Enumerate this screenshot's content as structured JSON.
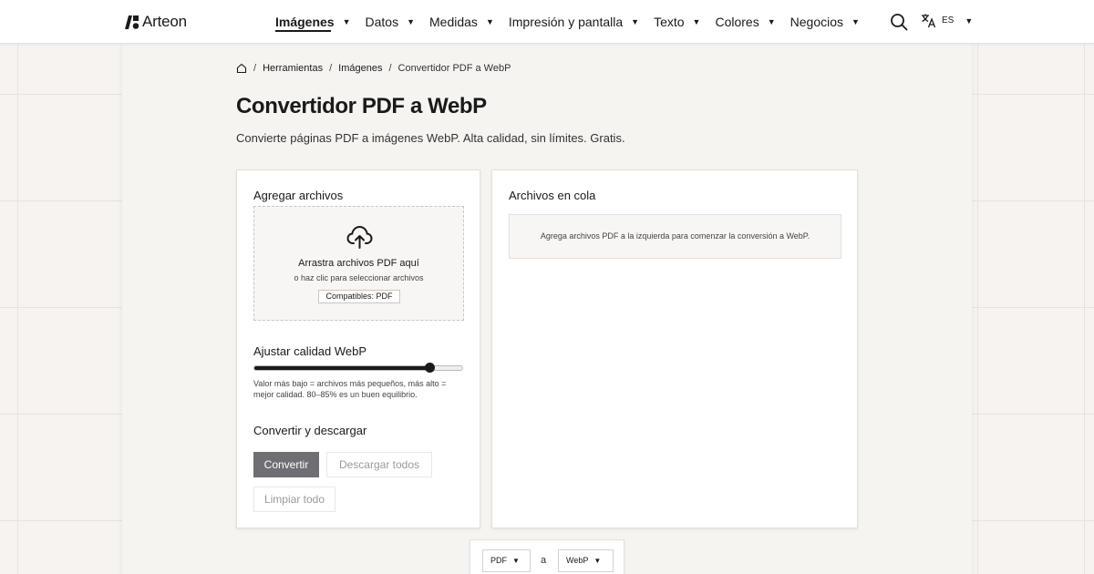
{
  "brand": {
    "name": "Arteon"
  },
  "nav": {
    "items": [
      {
        "label": "Imágenes",
        "active": true
      },
      {
        "label": "Datos"
      },
      {
        "label": "Medidas"
      },
      {
        "label": "Impresión y pantalla"
      },
      {
        "label": "Texto"
      },
      {
        "label": "Colores"
      },
      {
        "label": "Negocios"
      }
    ],
    "search_icon": "search-icon",
    "language": {
      "icon": "translate-icon",
      "code": "ES"
    }
  },
  "breadcrumb": {
    "items": [
      "Herramientas",
      "Imágenes",
      "Convertidor PDF a WebP"
    ],
    "separator": "/"
  },
  "page": {
    "title": "Convertidor PDF a WebP",
    "subtitle": "Convierte páginas PDF a imágenes WebP. Alta calidad, sin límites. Gratis."
  },
  "add_files": {
    "title": "Agregar archivos",
    "dropzone": {
      "icon": "cloud-upload-icon",
      "title": "Arrastra archivos PDF aquí",
      "subtitle": "o haz clic para seleccionar archivos",
      "badge": "Compatibles: PDF"
    }
  },
  "quality": {
    "title": "Ajustar calidad WebP",
    "value_fraction": 0.84,
    "hint": "Valor más bajo = archivos más pequeños, más alto = mejor calidad. 80–85% es un buen equilibrio."
  },
  "actions": {
    "title": "Convertir y descargar",
    "convert": "Convertir",
    "download_all": "Descargar todos",
    "clear_all": "Limpiar todo"
  },
  "queue": {
    "title": "Archivos en cola",
    "empty": "Agrega archivos PDF a la izquierda para comenzar la conversión a WebP."
  },
  "formats": {
    "from": "PDF",
    "to": "WebP",
    "joiner": "a"
  },
  "colors": {
    "background": "#f6f3f0",
    "primary_button": "#6e6e74",
    "text": "#1a1a1a"
  }
}
